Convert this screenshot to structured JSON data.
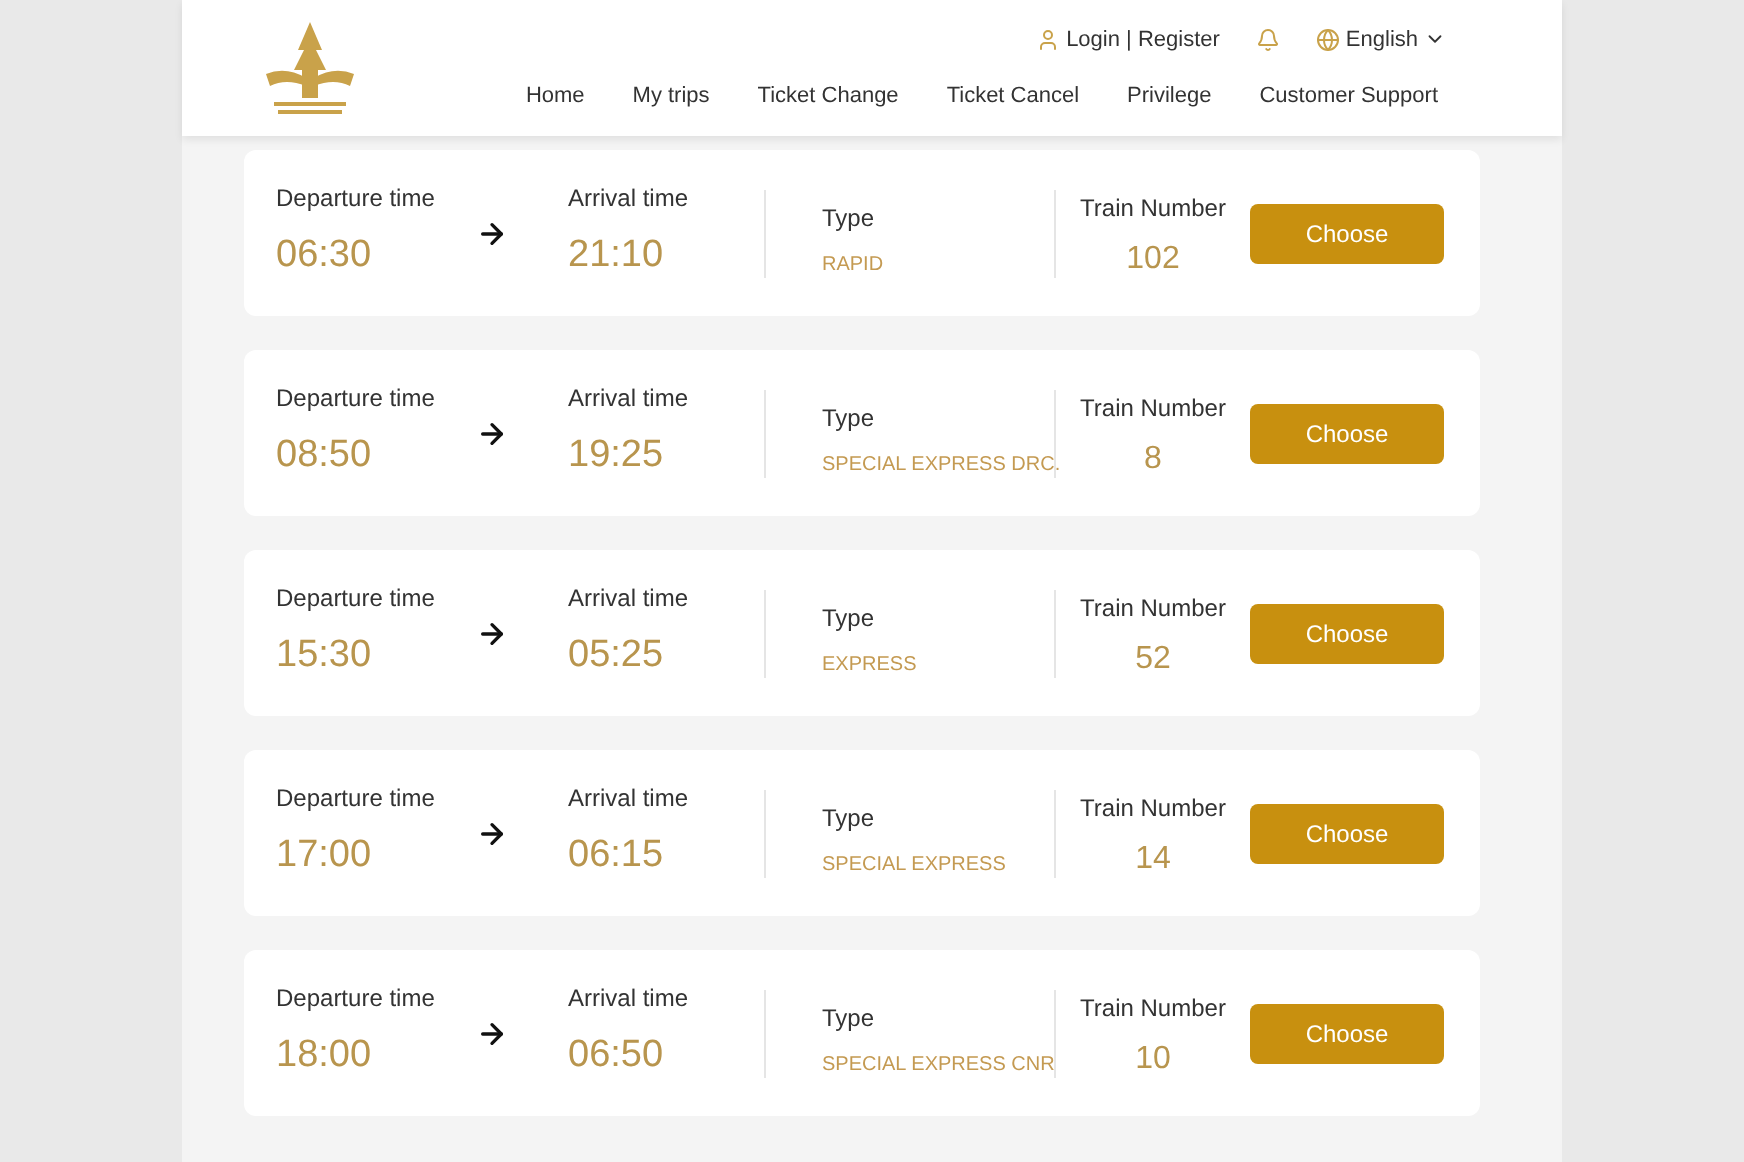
{
  "header": {
    "account_link": "Login | Register",
    "language": "English",
    "nav": [
      "Home",
      "My trips",
      "Ticket Change",
      "Ticket Cancel",
      "Privilege",
      "Customer Support"
    ]
  },
  "trips": [
    {
      "departure_label": "Departure time",
      "departure": "06:30",
      "arrival_label": "Arrival time",
      "arrival": "21:10",
      "type_label": "Type",
      "type": "RAPID",
      "train_label": "Train Number",
      "train": "102",
      "button": "Choose"
    },
    {
      "departure_label": "Departure time",
      "departure": "08:50",
      "arrival_label": "Arrival time",
      "arrival": "19:25",
      "type_label": "Type",
      "type": "SPECIAL EXPRESS DRC.",
      "train_label": "Train Number",
      "train": "8",
      "button": "Choose"
    },
    {
      "departure_label": "Departure time",
      "departure": "15:30",
      "arrival_label": "Arrival time",
      "arrival": "05:25",
      "type_label": "Type",
      "type": "EXPRESS",
      "train_label": "Train Number",
      "train": "52",
      "button": "Choose"
    },
    {
      "departure_label": "Departure time",
      "departure": "17:00",
      "arrival_label": "Arrival time",
      "arrival": "06:15",
      "type_label": "Type",
      "type": "SPECIAL EXPRESS",
      "train_label": "Train Number",
      "train": "14",
      "button": "Choose"
    },
    {
      "departure_label": "Departure time",
      "departure": "18:00",
      "arrival_label": "Arrival time",
      "arrival": "06:50",
      "type_label": "Type",
      "type": "SPECIAL EXPRESS CNR",
      "train_label": "Train Number",
      "train": "10",
      "button": "Choose"
    }
  ]
}
